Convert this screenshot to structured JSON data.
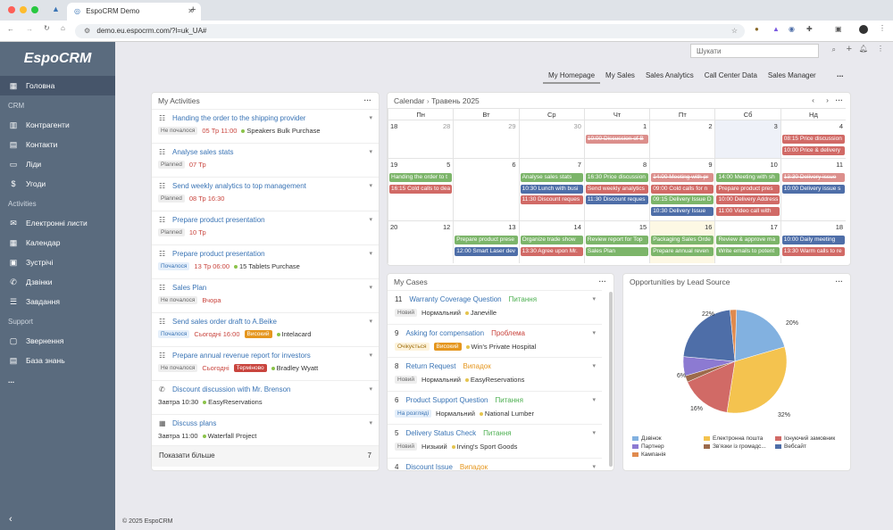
{
  "browser": {
    "tab_title": "EspoCRM Demo",
    "url": "demo.eu.espocrm.com/?l=uk_UA#"
  },
  "sidebar": {
    "logo": "EspoCRM",
    "items": [
      {
        "label": "Головна",
        "icon": "grid-icon"
      },
      {
        "label": "CRM",
        "section": true
      },
      {
        "label": "Контрагенти",
        "icon": "building-icon"
      },
      {
        "label": "Контакти",
        "icon": "contact-card-icon"
      },
      {
        "label": "Ліди",
        "icon": "id-card-icon"
      },
      {
        "label": "Угоди",
        "icon": "dollar-icon"
      },
      {
        "label": "Activities",
        "section": true
      },
      {
        "label": "Електронні листи",
        "icon": "envelope-icon"
      },
      {
        "label": "Календар",
        "icon": "calendar-icon"
      },
      {
        "label": "Зустрічі",
        "icon": "meeting-icon"
      },
      {
        "label": "Дзвінки",
        "icon": "phone-icon"
      },
      {
        "label": "Завдання",
        "icon": "tasks-icon"
      },
      {
        "label": "Support",
        "section": true
      },
      {
        "label": "Звернення",
        "icon": "inbox-icon"
      },
      {
        "label": "База знань",
        "icon": "book-icon"
      }
    ],
    "more": "...",
    "collapse": "‹"
  },
  "search": {
    "placeholder": "Шукати"
  },
  "tabs": [
    "My Homepage",
    "My Sales",
    "Sales Analytics",
    "Call Center Data",
    "Sales Manager"
  ],
  "tabs_more": "...",
  "activities": {
    "title": "My Activities",
    "items": [
      {
        "title": "Handing the order to the shipping provider",
        "status": "Не почалося",
        "date": "05 Тр 11:00",
        "date_red": true,
        "related": "Speakers Bulk Purchase",
        "icon": "task"
      },
      {
        "title": "Analyse sales stats",
        "status": "Planned",
        "date": "07 Тр",
        "date_red": true,
        "icon": "task"
      },
      {
        "title": "Send weekly analytics to top management",
        "status": "Planned",
        "date": "08 Тр 16:30",
        "date_red": true,
        "icon": "task"
      },
      {
        "title": "Prepare product presentation",
        "status": "Planned",
        "date": "10 Тр",
        "date_red": true,
        "icon": "task"
      },
      {
        "title": "Prepare product presentation",
        "status": "Почалося",
        "status_blue": true,
        "date": "13 Тр 06:00",
        "date_red": true,
        "related": "15 Tablets Purchase",
        "icon": "task"
      },
      {
        "title": "Sales Plan",
        "status": "Не почалося",
        "date": "Вчора",
        "date_red": true,
        "icon": "task"
      },
      {
        "title": "Send sales order draft to A.Beike",
        "status": "Почалося",
        "status_blue": true,
        "date": "Сьогодні 16:00",
        "date_red": true,
        "priority": "Високий",
        "priority_class": "orange",
        "related": "Intelacard",
        "icon": "task"
      },
      {
        "title": "Prepare annual revenue report for investors",
        "status": "Не почалося",
        "date": "Сьогодні",
        "date_red": true,
        "priority": "Терміново",
        "priority_class": "red",
        "related": "Bradley Wyatt",
        "icon": "task"
      },
      {
        "title": "Discount discussion with Mr. Brenson",
        "date": "Завтра 10:30",
        "related": "EasyReservations",
        "icon": "phone"
      },
      {
        "title": "Discuss plans",
        "date": "Завтра 11:00",
        "related": "Waterfall Project",
        "icon": "meeting"
      }
    ],
    "show_more": "Показати більше",
    "count": "7"
  },
  "calendar": {
    "title": "Calendar",
    "month": "Травень 2025",
    "days": [
      "Пн",
      "Вт",
      "Ср",
      "Чт",
      "Пт",
      "Сб",
      "Нд"
    ],
    "weeks": [
      {
        "week": "18",
        "dates": [
          "28",
          "29",
          "30",
          "1",
          "2",
          "3",
          "4"
        ]
      },
      {
        "week": "19",
        "dates": [
          "5",
          "6",
          "7",
          "8",
          "9",
          "10",
          "11"
        ]
      },
      {
        "week": "20",
        "dates": [
          "12",
          "13",
          "14",
          "15",
          "16",
          "17",
          "18"
        ]
      }
    ],
    "events": [
      [
        "10:00 Discussion of B",
        "08:15 Price discussion",
        "10:00 Price & delivery"
      ],
      [
        "Handing the order to t",
        "16:15 Cold calls to dea",
        "Analyse sales stats",
        "10:30 Lunch with busi",
        "11:30 Discount reques",
        "16:30 Price discussion",
        "Send weekly analytics",
        "11:30 Discount reques",
        "14:00 Meeting with pr",
        "09:00 Cold calls for n",
        "09:15 Delivery Issue D",
        "10:30 Delivery Issue",
        "14:00 Meeting with sh",
        "Prepare product pres",
        "10:00 Delivery Address",
        "11:00 Video call with",
        "13:30 Delivery issue",
        "10:00 Delivery issue s",
        "11:00 Lunch with top n"
      ],
      [
        "Prepare product prese",
        "12:00 Smart Laser dev",
        "Organize trade show",
        "13:30 Agree upon Mr.",
        "Review report for Top",
        "Sales Plan",
        "Packaging Sales Orde",
        "Prepare annual reven",
        "Review & approve ma",
        "Write emails to potent",
        "10:00 Daily meeting",
        "13:30 Warm calls to re"
      ]
    ]
  },
  "cases": {
    "title": "My Cases",
    "items": [
      {
        "num": "11",
        "title": "Warranty Coverage Question",
        "type": "Питання",
        "type_color": "#4caf50",
        "status": "Новий",
        "priority": "Нормальний",
        "account": "Janeville"
      },
      {
        "num": "9",
        "title": "Asking for compensation",
        "type": "Проблема",
        "type_color": "#c9453e",
        "status": "Очікується",
        "priority": "Високий",
        "priority_badge": true,
        "account": "Win's Private Hospital"
      },
      {
        "num": "8",
        "title": "Return Request",
        "type": "Випадок",
        "type_color": "#e5961e",
        "status": "Новий",
        "priority": "Нормальний",
        "account": "EasyReservations"
      },
      {
        "num": "6",
        "title": "Product Support Question",
        "type": "Питання",
        "type_color": "#4caf50",
        "status": "На розгляді",
        "priority": "Нормальний",
        "account": "National Lumber"
      },
      {
        "num": "5",
        "title": "Delivery Status Check",
        "type": "Питання",
        "type_color": "#4caf50",
        "status": "Новий",
        "priority": "Низький",
        "account": "Irving's Sport Goods"
      },
      {
        "num": "4",
        "title": "Discount Issue",
        "type": "Випадок",
        "type_color": "#e5961e"
      }
    ]
  },
  "chart_data": {
    "type": "pie",
    "title": "Opportunities by Lead Source",
    "slices": [
      {
        "label": "Дзвінок",
        "value": 20,
        "color": "#82b1e0"
      },
      {
        "label": "Електронна пошта",
        "value": 32,
        "color": "#f4c34f"
      },
      {
        "label": "Існуючий замовник",
        "value": 16,
        "color": "#d16a66"
      },
      {
        "label": "Партнер",
        "value": 6,
        "color": "#8c7ad2"
      },
      {
        "label": "Зв'язки із громадс...",
        "value": 2,
        "color": "#9c6a4b"
      },
      {
        "label": "Вебсайт",
        "value": 22,
        "color": "#4e6ea8"
      },
      {
        "label": "Кампанія",
        "value": 2,
        "color": "#e08a4e"
      }
    ],
    "slice_labels": [
      "20%",
      "32%",
      "16%",
      "6%",
      "22%"
    ],
    "legend_position": "bottom"
  },
  "footer": "© 2025 EspoCRM"
}
